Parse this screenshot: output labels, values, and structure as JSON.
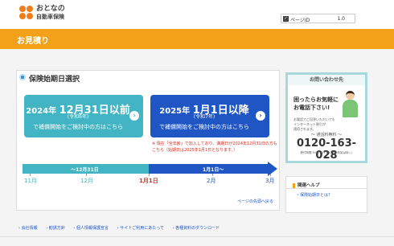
{
  "header": {
    "logo_line1": "おとなの",
    "logo_line2": "自動車保険",
    "page_id_label": "ページID",
    "page_id_value": "1.0"
  },
  "banner": {
    "title": "お見積り"
  },
  "section": {
    "title": "保険始期日選択"
  },
  "options": [
    {
      "prefix": "2024年",
      "date": "12月31日",
      "suffix": "以前",
      "era": "(令和6年)",
      "desc": "で補償開始をご検討中の方はこちら"
    },
    {
      "prefix": "2025年",
      "date": "1月1日",
      "suffix": "以降",
      "era": "(令和7年)",
      "desc": "で補償開始をご検討中の方はこちら"
    }
  ],
  "note": "※ 現在「全年齢」で加入しており、満期日が2024年12月31日の方もこちら（始期日は2025年1月1日となります。）",
  "timeline": {
    "left_label": "〜12月31日",
    "right_label": "1月1日〜",
    "months": [
      "11月",
      "12月",
      "1月1日",
      "2月",
      "3月"
    ]
  },
  "top_link": "ページの先頭へ戻る",
  "contact": {
    "header": "お問い合わせ先",
    "headline1": "困ったらお気軽に",
    "headline2": "お電話下さい!",
    "small1": "お電話でご回答いただいても",
    "small2": "インターネット割引が",
    "small3": "適用されます。",
    "free_label": "〜 通話料無料 〜",
    "tel": "0120-163-028",
    "hours": "受付時間 9:00〜17:30 (年末年始は除く)"
  },
  "help": {
    "header": "関連ヘルプ",
    "link": "・保険始期日とは?"
  },
  "footer": [
    "会社情報",
    "勧誘方針",
    "個人情報保護宣言",
    "サイトご利用にあたって",
    "各種資料のダウンロード"
  ],
  "colors": {
    "orange": "#f2a118",
    "teal": "#42b4c3",
    "blue": "#1f56c4",
    "red": "#d92a1d"
  }
}
